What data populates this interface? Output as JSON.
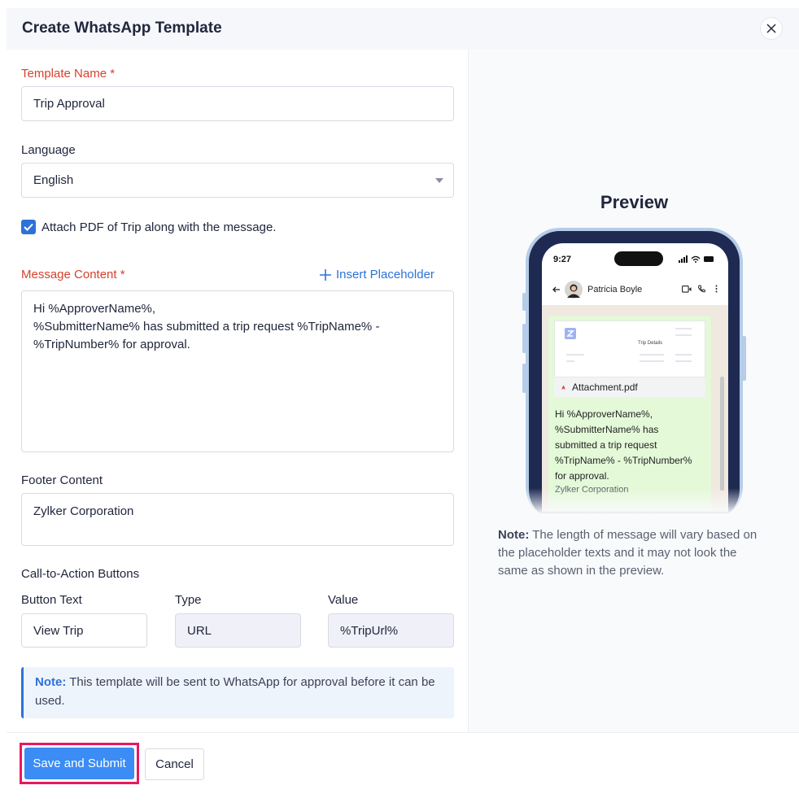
{
  "modal": {
    "title": "Create WhatsApp Template"
  },
  "form": {
    "template_name": {
      "label": "Template Name *",
      "value": "Trip Approval"
    },
    "language": {
      "label": "Language",
      "value": "English"
    },
    "attach_pdf": {
      "label": "Attach PDF of Trip along with the message.",
      "checked": true
    },
    "message": {
      "label": "Message Content *",
      "insert_placeholder": "Insert Placeholder",
      "lines": [
        "Hi %ApproverName%,",
        "%SubmitterName% has submitted a trip request %TripName% -",
        "%TripNumber% for approval."
      ]
    },
    "footer": {
      "label": "Footer Content",
      "value": "Zylker Corporation"
    },
    "cta": {
      "label": "Call-to-Action Buttons",
      "columns": [
        "Button Text",
        "Type",
        "Value"
      ],
      "button_text": "View Trip",
      "type": "URL",
      "value": "%TripUrl%"
    },
    "note": {
      "prefix": "Note:",
      "text": " This template will be sent to WhatsApp for approval before it can be used."
    }
  },
  "actions": {
    "save_label": "Save and Submit",
    "cancel_label": "Cancel"
  },
  "preview": {
    "title": "Preview",
    "time": "9:27",
    "contact_name": "Patricia Boyle",
    "doc_heading": "Trip Details",
    "attachment_name": "Attachment.pdf",
    "bubble_lines": [
      "Hi %ApproverName%,",
      "%SubmitterName% has",
      "submitted a trip request",
      "%TripName% - %TripNumber%",
      "for approval."
    ],
    "footer_text": "Zylker Corporation",
    "note_prefix": "Note:",
    "note_text": " The length of message will vary based on the placeholder texts and it may not look the same as shown in the preview."
  },
  "colors": {
    "accent": "#2d72d9",
    "primary": "#3b8cf5",
    "required": "#d6412e",
    "highlight": "#e8185f"
  }
}
